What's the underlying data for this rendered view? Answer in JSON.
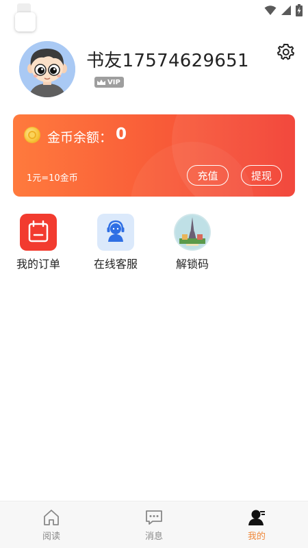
{
  "status_bar": {
    "icons": [
      "wifi-icon",
      "cellular-signal-icon",
      "battery-charging-icon"
    ]
  },
  "profile": {
    "username": "书友17574629651",
    "vip_label": "VIP",
    "avatar_icon": "avatar-cartoon-boy"
  },
  "wallet": {
    "balance_label": "金币余额：",
    "balance_value": "0",
    "rate_text": "1元=10金币",
    "recharge_label": "充值",
    "withdraw_label": "提现",
    "gradient_colors": [
      "#ff7a3d",
      "#f23b2f"
    ]
  },
  "shortcuts": [
    {
      "label": "我的订单",
      "icon": "calendar-order-icon"
    },
    {
      "label": "在线客服",
      "icon": "customer-service-icon"
    },
    {
      "label": "解锁码",
      "icon": "eiffel-tower-icon"
    }
  ],
  "bottom_nav": {
    "items": [
      {
        "label": "阅读",
        "icon": "home-icon",
        "active": false
      },
      {
        "label": "消息",
        "icon": "message-icon",
        "active": false
      },
      {
        "label": "我的",
        "icon": "user-icon",
        "active": true
      }
    ],
    "active_color": "#f0883a",
    "inactive_color": "#888888"
  }
}
